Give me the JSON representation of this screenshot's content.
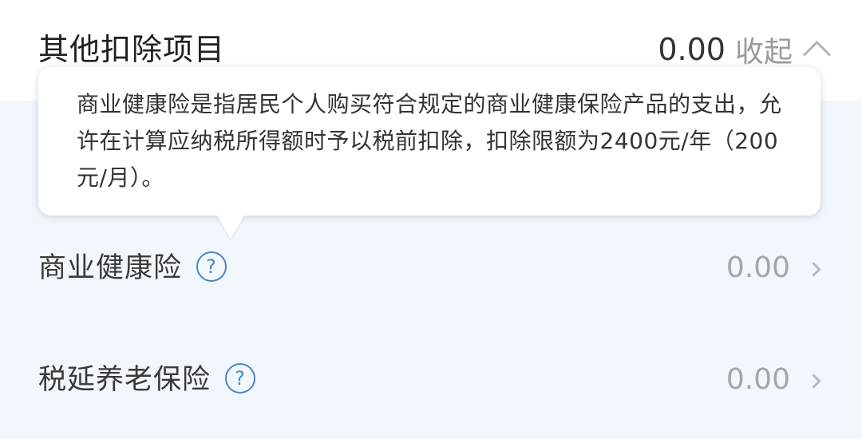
{
  "header": {
    "title": "其他扣除项目",
    "amount": "0.00",
    "collapse_label": "收起",
    "collapse_icon": "chevron-up-icon"
  },
  "tooltip": {
    "text": "商业健康险是指居民个人购买符合规定的商业健康保险产品的支出，允许在计算应纳税所得额时予以税前扣除，扣除限额为2400元/年（200元/月）。"
  },
  "rows": [
    {
      "label": "商业健康险",
      "help_icon": "question-circle-icon",
      "help_glyph": "?",
      "value": "0.00"
    },
    {
      "label": "税延养老保险",
      "help_icon": "question-circle-icon",
      "help_glyph": "?",
      "value": "0.00"
    }
  ],
  "colors": {
    "list_background": "#f1f7fd",
    "help_icon": "#4a86c8",
    "value_text": "#a6a6a6"
  }
}
